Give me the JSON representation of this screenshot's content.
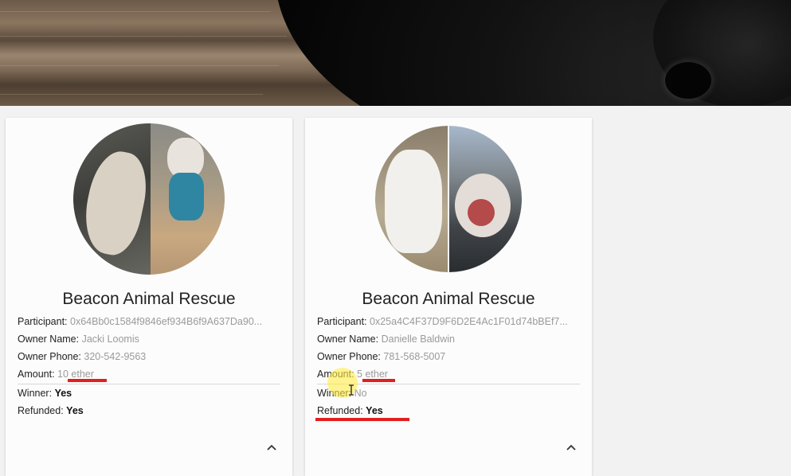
{
  "banner": {
    "description_icon": "dog-photo-banner"
  },
  "cards": [
    {
      "title": "Beacon Animal Rescue",
      "participant_label": "Participant:",
      "participant_value": "0x64Bb0c1584f9846ef934B6f9A637Da90...",
      "owner_name_label": "Owner Name:",
      "owner_name_value": "Jacki Loomis",
      "owner_phone_label": "Owner Phone:",
      "owner_phone_value": "320-542-9563",
      "amount_label": "Amount:",
      "amount_value": "10 ether",
      "winner_label": "Winner:",
      "winner_value": "Yes",
      "refunded_label": "Refunded:",
      "refunded_value": "Yes",
      "expand_icon": "chevron-up-icon"
    },
    {
      "title": "Beacon Animal Rescue",
      "participant_label": "Participant:",
      "participant_value": "0x25a4C4F37D9F6D2E4Ac1F01d74bBEf7...",
      "owner_name_label": "Owner Name:",
      "owner_name_value": "Danielle Baldwin",
      "owner_phone_label": "Owner Phone:",
      "owner_phone_value": "781-568-5007",
      "amount_label": "Amount:",
      "amount_value": "5 ether",
      "winner_label": "Winner:",
      "winner_value": "No",
      "refunded_label": "Refunded:",
      "refunded_value": "Yes",
      "expand_icon": "chevron-up-icon"
    }
  ],
  "colors": {
    "annotation_red": "#e02020",
    "cursor_highlight": "#ffec46",
    "value_gray": "#9a9a9a"
  }
}
